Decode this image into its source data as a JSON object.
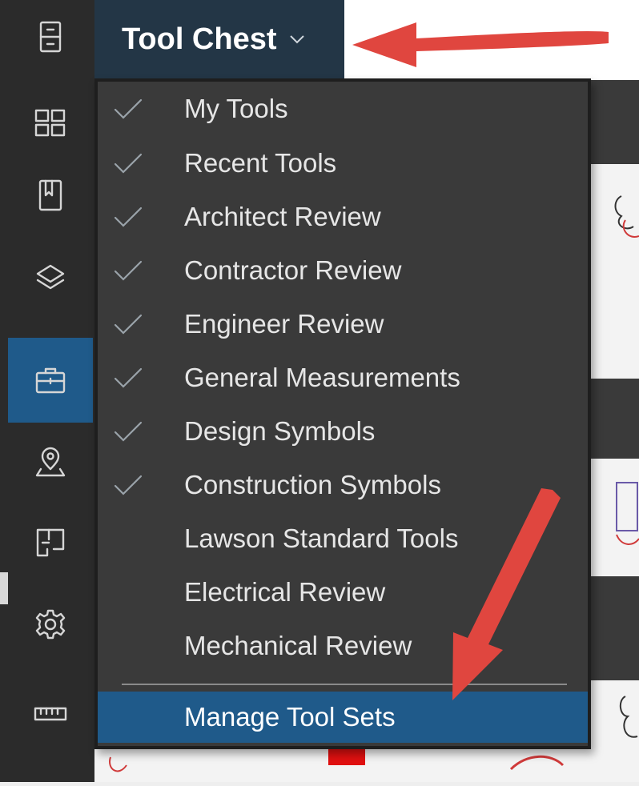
{
  "header": {
    "tool_chest_label": "Tool Chest"
  },
  "sidebar": {
    "items": [
      {
        "icon": "file-cabinet-icon"
      },
      {
        "icon": "thumbnails-grid-icon"
      },
      {
        "icon": "bookmark-icon"
      },
      {
        "icon": "layers-icon"
      },
      {
        "icon": "toolbox-icon",
        "active": true
      },
      {
        "icon": "location-pin-icon"
      },
      {
        "icon": "spaces-icon"
      },
      {
        "icon": "gear-icon"
      },
      {
        "icon": "ruler-icon"
      }
    ]
  },
  "menu": {
    "items": [
      {
        "label": "My Tools",
        "checked": true
      },
      {
        "label": "Recent Tools",
        "checked": true
      },
      {
        "label": "Architect Review",
        "checked": true
      },
      {
        "label": "Contractor Review",
        "checked": true
      },
      {
        "label": "Engineer Review",
        "checked": true
      },
      {
        "label": "General Measurements",
        "checked": true
      },
      {
        "label": "Design Symbols",
        "checked": true
      },
      {
        "label": "Construction Symbols",
        "checked": true
      },
      {
        "label": "Lawson Standard Tools",
        "checked": false
      },
      {
        "label": "Electrical Review",
        "checked": false
      },
      {
        "label": "Mechanical Review",
        "checked": false
      }
    ],
    "manage_label": "Manage Tool Sets"
  },
  "colors": {
    "sidebar_bg": "#2b2b2b",
    "active_blue": "#1f5a8a",
    "header_button_bg": "#233646",
    "menu_bg": "#3a3a3a",
    "annotation_arrow": "#e0463f"
  }
}
